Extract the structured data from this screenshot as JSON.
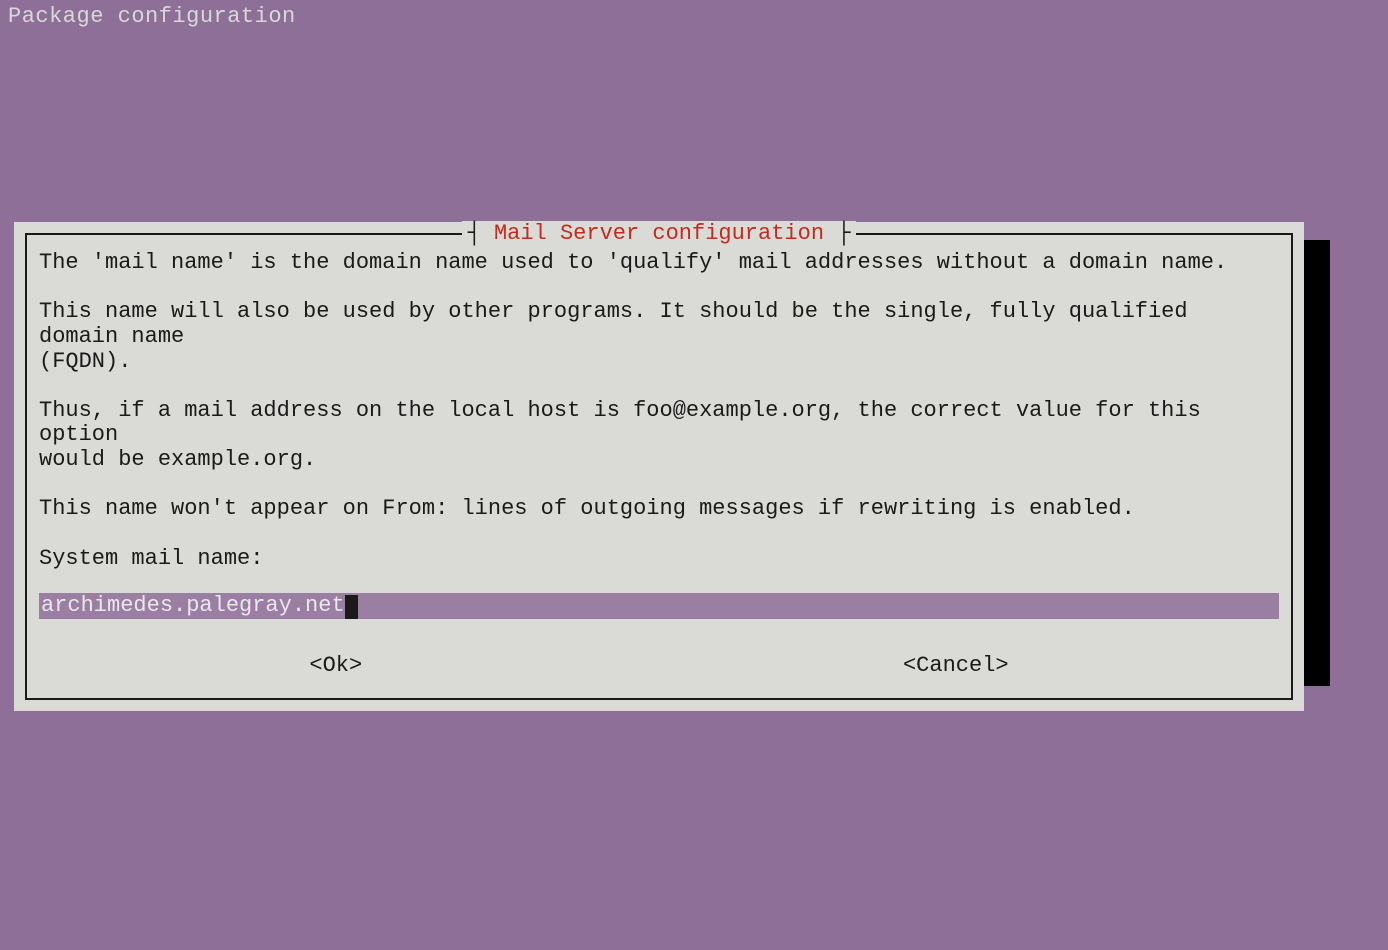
{
  "screen": {
    "title": "Package configuration"
  },
  "dialog": {
    "title": "Mail Server configuration",
    "body": "The 'mail name' is the domain name used to 'qualify' mail addresses without a domain name.\n\nThis name will also be used by other programs. It should be the single, fully qualified domain name\n(FQDN).\n\nThus, if a mail address on the local host is foo@example.org, the correct value for this option\nwould be example.org.\n\nThis name won't appear on From: lines of outgoing messages if rewriting is enabled.\n\nSystem mail name:",
    "input_value": "archimedes.palegray.net",
    "buttons": {
      "ok": "<Ok>",
      "cancel": "<Cancel>"
    }
  },
  "colors": {
    "background": "#8e6f97",
    "dialog_bg": "#dadad6",
    "title_red": "#c42b1c",
    "input_bg": "#9a7fa3"
  }
}
